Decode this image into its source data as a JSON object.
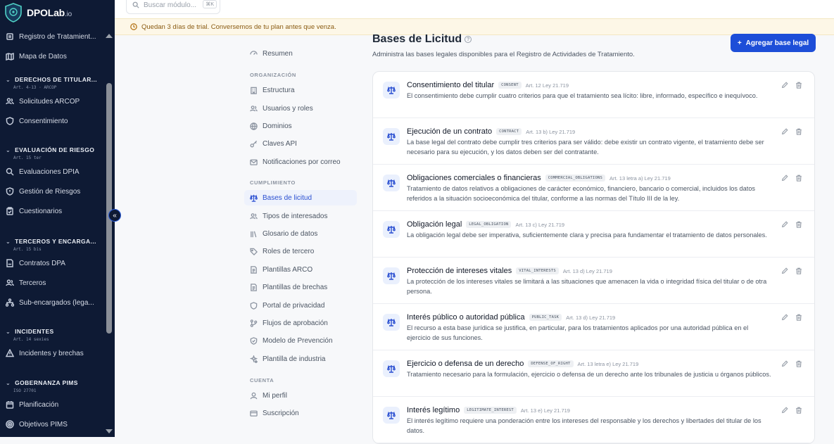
{
  "app": {
    "name": "DPOLab",
    "name_suffix": ".io"
  },
  "search": {
    "placeholder": "Buscar módulo...",
    "shortcut": "⌘K"
  },
  "trial_banner": "Quedan 3 días de trial. Conversemos de tu plan antes que venza.",
  "sidebar": {
    "top_items": [
      {
        "label": "Registro de Tratamient...",
        "icon": "list-icon"
      },
      {
        "label": "Mapa de Datos",
        "icon": "map-icon"
      }
    ],
    "sections": [
      {
        "title": "DERECHOS DE TITULAR...",
        "sub": "Art. 4-13 · ARCOP",
        "items": [
          {
            "label": "Solicitudes ARCOP",
            "icon": "users-icon"
          },
          {
            "label": "Consentimiento",
            "icon": "shield-icon"
          }
        ]
      },
      {
        "title": "EVALUACIÓN DE RIESGO",
        "sub": "Art. 15 ter",
        "items": [
          {
            "label": "Evaluaciones DPIA",
            "icon": "search-icon"
          },
          {
            "label": "Gestión de Riesgos",
            "icon": "shield-alert-icon"
          },
          {
            "label": "Cuestionarios",
            "icon": "clipboard-icon"
          }
        ]
      },
      {
        "title": "TERCEROS Y ENCARGA...",
        "sub": "Art. 15 bis",
        "items": [
          {
            "label": "Contratos DPA",
            "icon": "contract-icon"
          },
          {
            "label": "Terceros",
            "icon": "users-icon"
          },
          {
            "label": "Sub-encargados (lega...",
            "icon": "network-icon"
          }
        ]
      },
      {
        "title": "INCIDENTES",
        "sub": "Art. 14 sexies",
        "items": [
          {
            "label": "Incidentes y brechas",
            "icon": "warning-icon"
          }
        ]
      },
      {
        "title": "GOBERNANZA PIMS",
        "sub": "ISO 27701",
        "items": [
          {
            "label": "Planificación",
            "icon": "calendar-icon"
          },
          {
            "label": "Objetivos PIMS",
            "icon": "target-icon"
          }
        ]
      }
    ]
  },
  "settings_nav": {
    "resumen": "Resumen",
    "org_title": "ORGANIZACIÓN",
    "org_items": [
      "Estructura",
      "Usuarios y roles",
      "Dominios",
      "Claves API",
      "Notificaciones por correo"
    ],
    "cumplimiento_title": "CUMPLIMIENTO",
    "cumplimiento_items": [
      "Bases de licitud",
      "Tipos de interesados",
      "Glosario de datos",
      "Roles de tercero",
      "Plantillas ARCO",
      "Plantillas de brechas",
      "Portal de privacidad",
      "Flujos de aprobación",
      "Modelo de Prevención",
      "Plantilla de industria"
    ],
    "cuenta_title": "CUENTA",
    "cuenta_items": [
      "Mi perfil",
      "Suscripción"
    ],
    "active": "Bases de licitud"
  },
  "page": {
    "title": "Bases de Licitud",
    "subtitle": "Administra las bases legales disponibles para el Registro de Actividades de Tratamiento.",
    "add_button": "Agregar base legal"
  },
  "bases": [
    {
      "name": "Consentimiento del titular",
      "code": "CONSENT",
      "ref": "Art. 12 Ley 21.719",
      "desc": "El consentimiento debe cumplir cuatro criterios para que el tratamiento sea lícito: libre, informado, específico e inequívoco."
    },
    {
      "name": "Ejecución de un contrato",
      "code": "CONTRACT",
      "ref": "Art. 13 b) Ley 21.719",
      "desc": "La base legal del contrato debe cumplir tres criterios para ser válido: debe existir un contrato vigente, el tratamiento debe ser necesario para su ejecución, y los datos deben ser del contratante."
    },
    {
      "name": "Obligaciones comerciales o financieras",
      "code": "COMMERCIAL_OBLIGATIONS",
      "ref": "Art. 13 letra a) Ley 21.719",
      "desc": "Tratamiento de datos relativos a obligaciones de carácter económico, financiero, bancario o comercial, incluidos los datos referidos a la situación socioeconómica del titular, conforme a las normas del Título III de la ley."
    },
    {
      "name": "Obligación legal",
      "code": "LEGAL_OBLIGATION",
      "ref": "Art. 13 c) Ley 21.719",
      "desc": "La obligación legal debe ser imperativa, suficientemente clara y precisa para fundamentar el tratamiento de datos personales."
    },
    {
      "name": "Protección de intereses vitales",
      "code": "VITAL_INTERESTS",
      "ref": "Art. 13 d) Ley 21.719",
      "desc": "La protección de los intereses vitales se limitará a las situaciones que amenacen la vida o integridad física del titular o de otra persona."
    },
    {
      "name": "Interés público o autoridad pública",
      "code": "PUBLIC_TASK",
      "ref": "Art. 13 d) Ley 21.719",
      "desc": "El recurso a esta base jurídica se justifica, en particular, para los tratamientos aplicados por una autoridad pública en el ejercicio de sus funciones."
    },
    {
      "name": "Ejercicio o defensa de un derecho",
      "code": "DEFENSE_OF_RIGHT",
      "ref": "Art. 13 letra e) Ley 21.719",
      "desc": "Tratamiento necesario para la formulación, ejercicio o defensa de un derecho ante los tribunales de justicia u órganos públicos."
    },
    {
      "name": "Interés legítimo",
      "code": "LEGITIMATE_INTEREST",
      "ref": "Art. 13 e) Ley 21.719",
      "desc": "El interés legítimo requiere una ponderación entre los intereses del responsable y los derechos y libertades del titular de los datos."
    }
  ]
}
